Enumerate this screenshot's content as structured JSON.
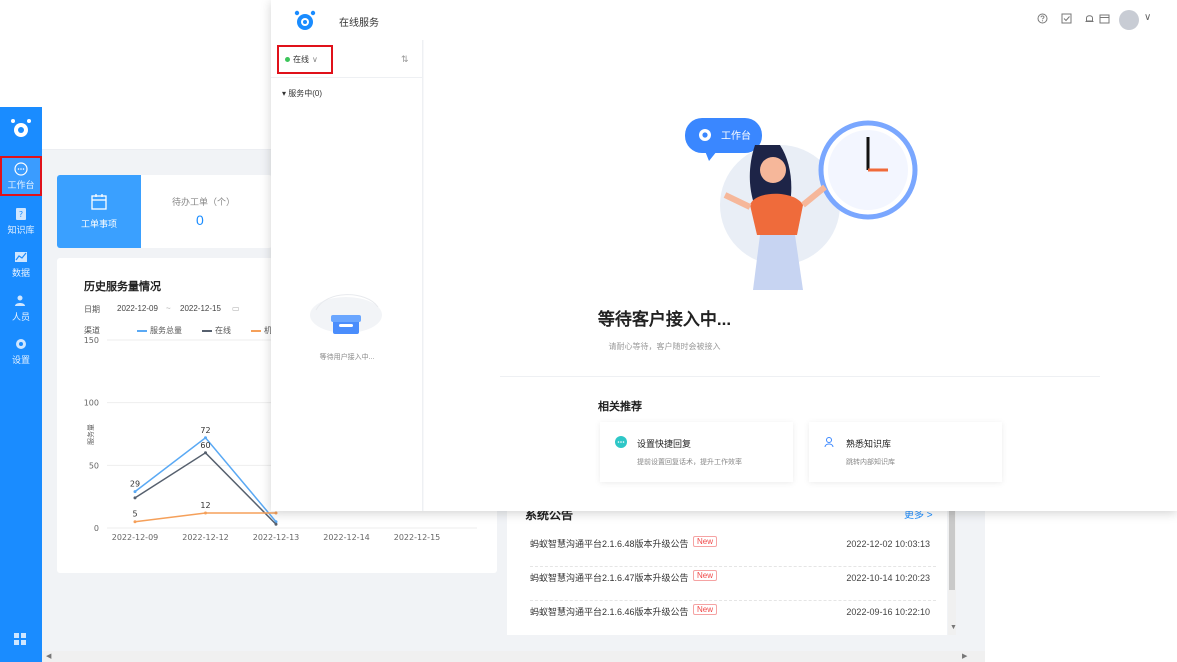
{
  "sidebar": {
    "items": [
      {
        "label": "工作台",
        "icon": "chat-bubble-icon"
      },
      {
        "label": "知识库",
        "icon": "help-book-icon"
      },
      {
        "label": "数据",
        "icon": "chart-icon"
      },
      {
        "label": "人员",
        "icon": "people-icon"
      },
      {
        "label": "设置",
        "icon": "gear-icon"
      }
    ]
  },
  "dashboard": {
    "work_tile_label": "工单事项",
    "pending_label": "待办工单（个）",
    "pending_value": "0",
    "history": {
      "title": "历史服务量情况",
      "date_label": "日期",
      "date_start": "2022-12-09",
      "date_sep": "~",
      "date_end": "2022-12-15",
      "legend_title": "渠道",
      "legend": [
        "服务总量",
        "在线",
        "机"
      ]
    }
  },
  "chart_data": {
    "type": "line",
    "categories": [
      "2022-12-09",
      "2022-12-12",
      "2022-12-13",
      "2022-12-14",
      "2022-12-15"
    ],
    "ylim": [
      0,
      150
    ],
    "yticks": [
      0,
      50,
      100,
      150
    ],
    "ylabel": "服务量",
    "series": [
      {
        "name": "服务总量",
        "color": "#5aa9f4",
        "values": [
          29,
          72,
          5,
          null,
          null
        ]
      },
      {
        "name": "在线",
        "color": "#56606e",
        "values": [
          24,
          60,
          3,
          null,
          null
        ]
      },
      {
        "name": "机",
        "color": "#f5a05a",
        "values": [
          5,
          12,
          12,
          null,
          null
        ]
      }
    ],
    "point_labels": [
      {
        "series": 0,
        "index": 0,
        "text": "29"
      },
      {
        "series": 0,
        "index": 1,
        "text": "72"
      },
      {
        "series": 1,
        "index": 1,
        "text": "60"
      },
      {
        "series": 2,
        "index": 0,
        "text": "5"
      },
      {
        "series": 2,
        "index": 1,
        "text": "12"
      }
    ]
  },
  "notices": {
    "title": "系统公告",
    "more": "更多 >",
    "items": [
      {
        "text": "蚂蚁智慧沟通平台2.1.6.48版本升级公告",
        "badge": "New",
        "time": "2022-12-02 10:03:13"
      },
      {
        "text": "蚂蚁智慧沟通平台2.1.6.47版本升级公告",
        "badge": "New",
        "time": "2022-10-14 10:20:23"
      },
      {
        "text": "蚂蚁智慧沟通平台2.1.6.46版本升级公告",
        "badge": "New",
        "time": "2022-09-16 10:22:10"
      }
    ]
  },
  "popup": {
    "title": "在线服务",
    "status": "在线",
    "serving_label": "服务中(0)",
    "empty_text": "等待用户接入中...",
    "bubble_label": "工作台",
    "waiting_title": "等待客户接入中...",
    "waiting_sub": "请耐心等待，客户随时会被接入",
    "rec_title": "相关推荐",
    "recommendations": [
      {
        "title": "设置快捷回复",
        "desc": "提前设置回复话术，提升工作效率"
      },
      {
        "title": "熟悉知识库",
        "desc": "跳转内部知识库"
      }
    ]
  },
  "colors": {
    "primary": "#1a8cff",
    "highlight_box": "#e0111a",
    "online_dot": "#3cc55b"
  }
}
